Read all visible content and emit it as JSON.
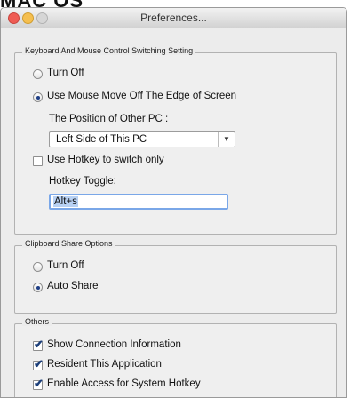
{
  "window": {
    "title": "Preferences..."
  },
  "top_overflow_text": "MAC OS",
  "keyboard_group": {
    "legend": "Keyboard And Mouse Control Switching Setting",
    "turn_off": "Turn Off",
    "mouse_edge": "Use Mouse Move Off The Edge of Screen",
    "position_label": "The Position of Other PC :",
    "position_value": "Left Side of This PC",
    "hotkey_only": "Use Hotkey to switch only",
    "hotkey_label": "Hotkey Toggle:",
    "hotkey_value": "Alt+s",
    "selected": "mouse_edge",
    "hotkey_only_checked": false
  },
  "clipboard_group": {
    "legend": "Clipboard Share Options",
    "turn_off": "Turn Off",
    "auto_share": "Auto Share",
    "selected": "auto_share"
  },
  "others_group": {
    "legend": "Others",
    "show_connection": "Show Connection Information",
    "resident": "Resident This Application",
    "system_hotkey": "Enable Access for System Hotkey",
    "show_connection_checked": true,
    "resident_checked": true,
    "system_hotkey_checked": true
  },
  "icons": {
    "checkmark": "✔",
    "dropdown_arrow": "▼"
  }
}
